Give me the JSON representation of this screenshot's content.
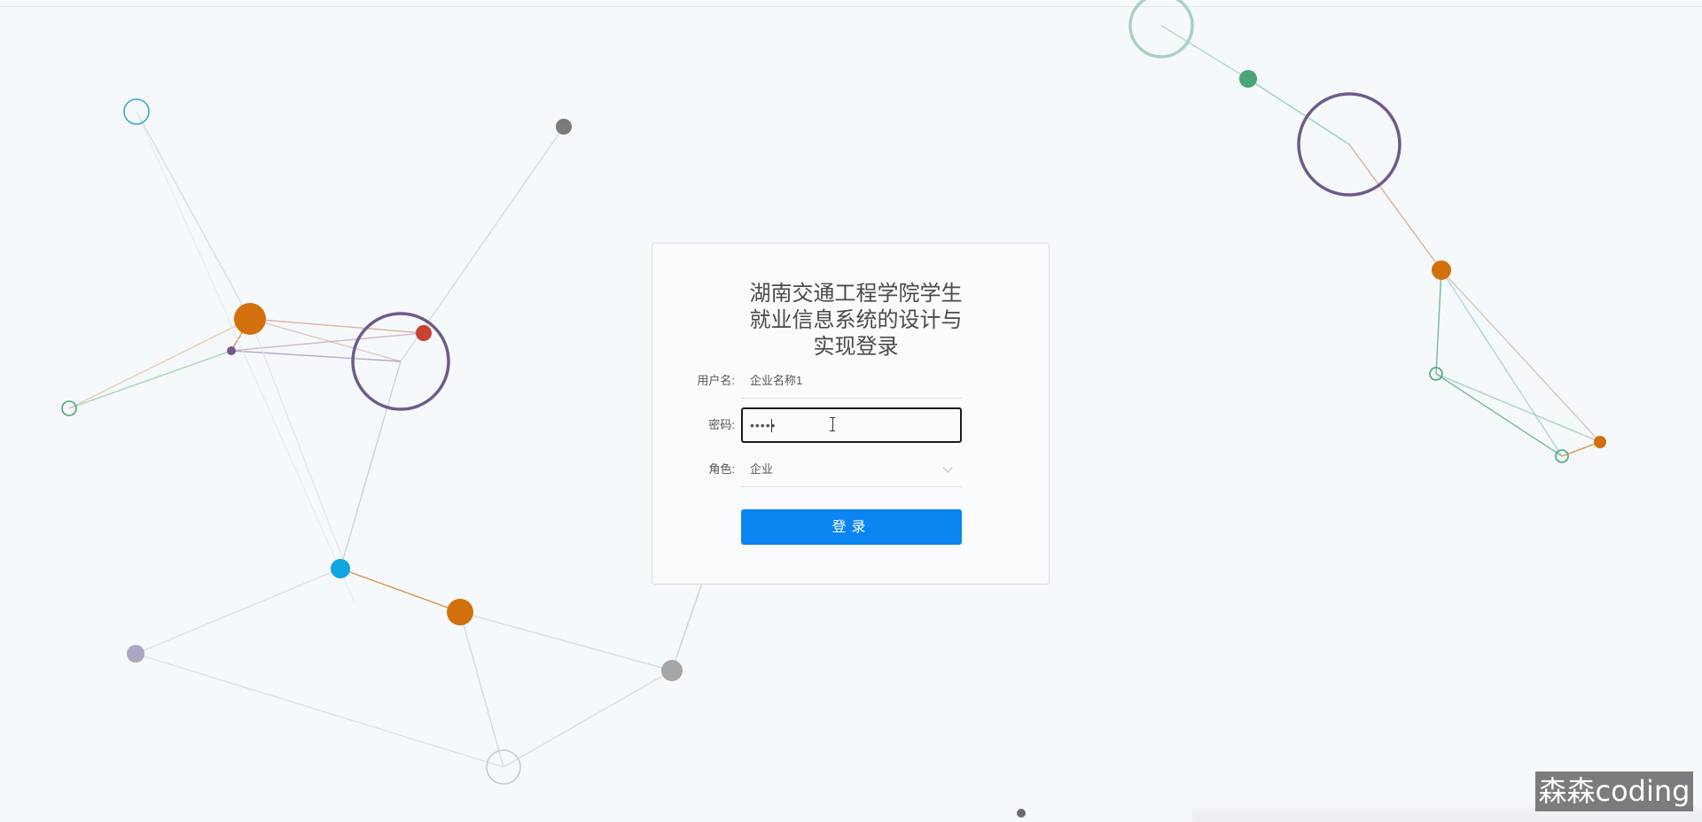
{
  "login": {
    "title": "湖南交通工程学院学生\n就业信息系统的设计与\n实现登录",
    "username_label": "用户名:",
    "username_value": "企业名称1",
    "password_label": "密码:",
    "password_value": "•••••",
    "role_label": "角色:",
    "role_selected": "企业",
    "submit_label": "登录"
  },
  "watermark": "森森coding",
  "colors": {
    "accent": "#0a85f2",
    "background": "#f6f9fb",
    "node_orange": "#d2700d",
    "node_purple": "#6e5a8c",
    "node_red": "#c84232",
    "node_blue": "#0ea5e0",
    "node_green": "#4aa574",
    "node_gray": "#7b7b7b"
  },
  "icons": {
    "role_dropdown": "chevron-down-icon",
    "cursor": "text-cursor-icon"
  }
}
